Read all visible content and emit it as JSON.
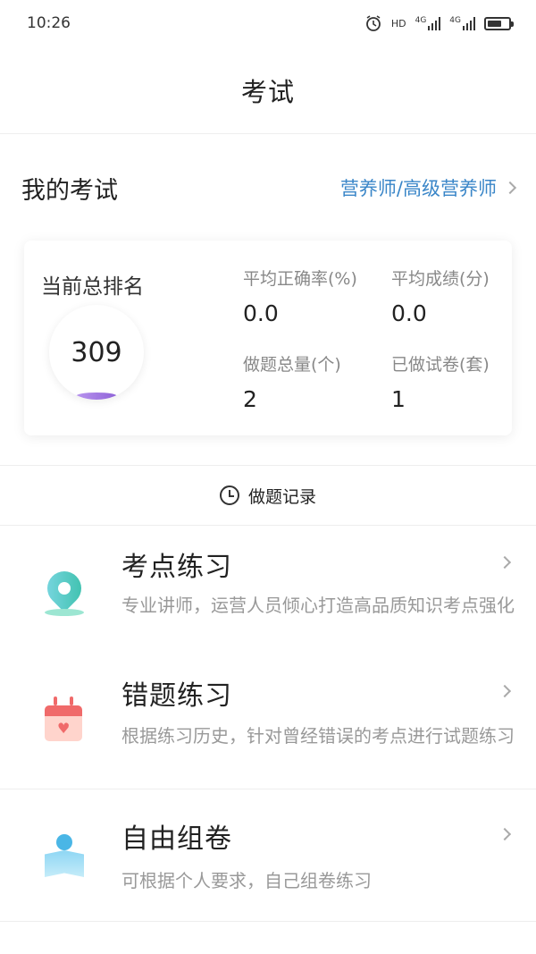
{
  "status_bar": {
    "time": "10:26",
    "hd": "HD",
    "net1": "4G",
    "net2": "4G"
  },
  "nav": {
    "title": "考试"
  },
  "my_exam": {
    "title": "我的考试",
    "link": "营养师/高级营养师"
  },
  "stats": {
    "rank_label": "当前总排名",
    "rank_value": "309",
    "items": [
      {
        "label": "平均正确率(%)",
        "value": "0.0"
      },
      {
        "label": "平均成绩(分)",
        "value": "0.0"
      },
      {
        "label": "做题总量(个)",
        "value": "2"
      },
      {
        "label": "已做试卷(套)",
        "value": "1"
      }
    ]
  },
  "record": {
    "label": "做题记录"
  },
  "practice": [
    {
      "title": "考点练习",
      "desc": "专业讲师，运营人员倾心打造高品质知识考点强化",
      "icon": "location-pin-icon"
    },
    {
      "title": "错题练习",
      "desc": "根据练习历史，针对曾经错误的考点进行试题练习",
      "icon": "calendar-heart-icon"
    },
    {
      "title": "自由组卷",
      "desc": "可根据个人要求，自己组卷练习",
      "icon": "reader-icon"
    }
  ],
  "colors": {
    "accent": "#3a86c8",
    "pin": "#38bfa8",
    "calendar": "#f06a6a",
    "reader": "#4ab6e6"
  }
}
